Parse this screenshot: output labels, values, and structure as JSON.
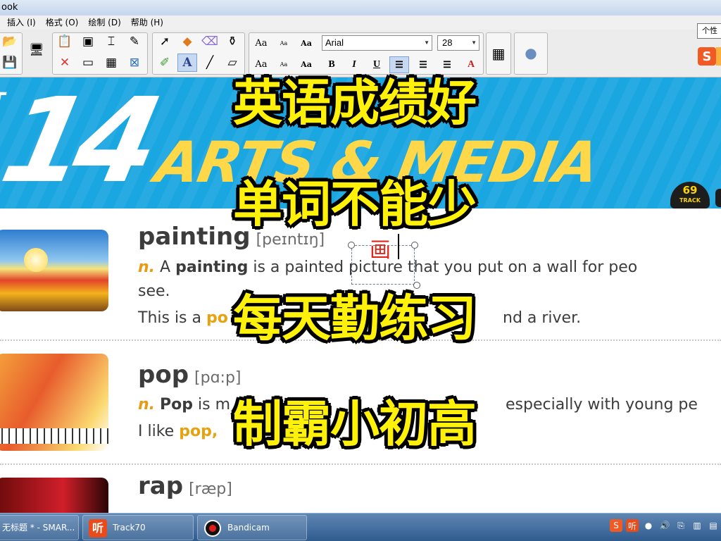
{
  "window": {
    "title": "ook"
  },
  "menu": {
    "items": [
      "插入 (I)",
      "格式 (O)",
      "绘制 (D)",
      "帮助 (H)"
    ]
  },
  "toolbar": {
    "font_name": "Arial",
    "font_size": "28",
    "style_labels": {
      "aa_large": "Aa",
      "aa_small": "Aa",
      "aa_bold": "Aa",
      "bold": "B",
      "italic": "I",
      "underline": "U",
      "color_a": "A"
    },
    "tooltip": "个性"
  },
  "banner": {
    "unit_word": "IT",
    "unit_number": "14",
    "title": "ARTS & MEDIA",
    "track_number": "69",
    "track_label": "TRACK"
  },
  "entries": [
    {
      "word": "painting",
      "phonetic": "[peɪntɪŋ]",
      "pos": "n.",
      "def_a": "A",
      "def_bold": "painting",
      "def_rest": "is a painted picture that you put on a wall for peo",
      "def_line2": "see.",
      "example_pre": "This is a",
      "example_highlight": "po",
      "example_post": "nd a river."
    },
    {
      "word": "pop",
      "phonetic": "[pɑ:p]",
      "pos": "n.",
      "def_bold": "Pop",
      "def_rest": "is m",
      "def_tail": "especially with young pe",
      "example_pre": "I like",
      "example_highlight": "pop,"
    },
    {
      "word": "rap",
      "phonetic": "[ræp]"
    }
  ],
  "textbox": {
    "text": "画"
  },
  "overlay": {
    "line1": "英语成绩好",
    "line2": "单词不能少",
    "line3": "每天勤练习",
    "line4": "制霸小初高"
  },
  "taskbar": {
    "tasks": [
      {
        "label": "无标题 * - SMAR...",
        "icon": "smart-notebook-icon"
      },
      {
        "label": "Track70",
        "icon": "listen-app-icon",
        "glyph": "听"
      },
      {
        "label": "Bandicam",
        "icon": "record-icon"
      }
    ]
  },
  "colors": {
    "banner_blue": "#1aa6e0",
    "title_yellow": "#ffd84a",
    "caption_yellow": "#fff10a",
    "accent_orange": "#e79b14"
  }
}
